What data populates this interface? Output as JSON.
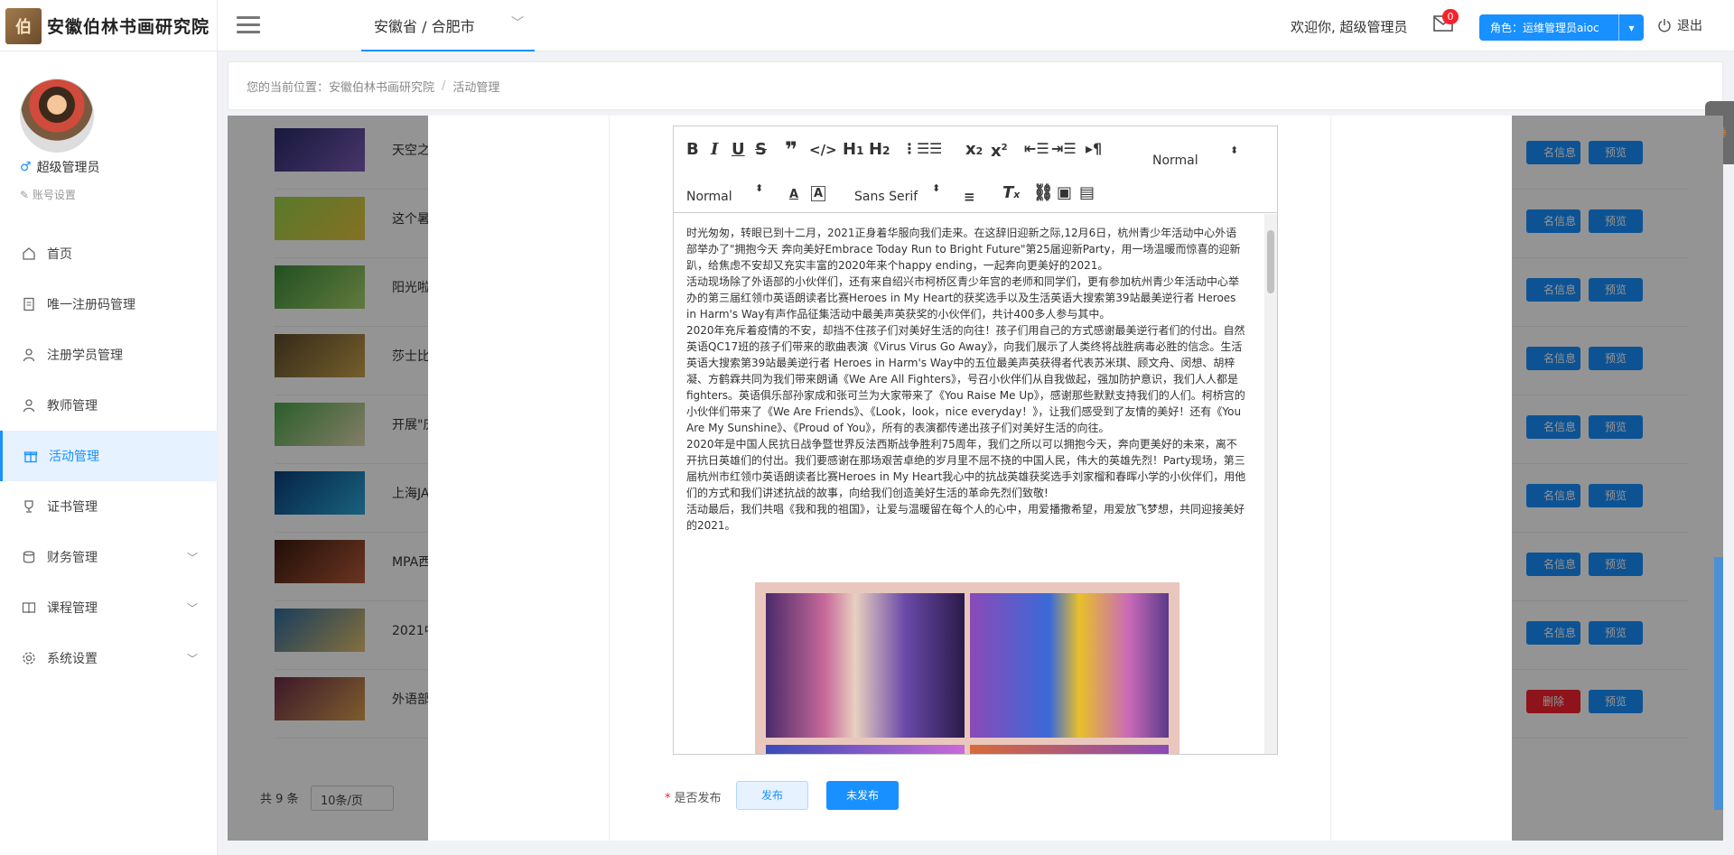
{
  "app": {
    "logo_mark": "伯",
    "logo_text": "安徽伯林书画研究院"
  },
  "header": {
    "region": "安徽省 / 合肥市",
    "welcome": "欢迎你, 超级管理员",
    "mail_count": "0",
    "role": "角色：运维管理员aioc",
    "logout": "退出"
  },
  "user": {
    "name": "超级管理员",
    "account_settings": "账号设置"
  },
  "sidebar": {
    "items": [
      {
        "label": "首页",
        "icon": "home-icon"
      },
      {
        "label": "唯一注册码管理",
        "icon": "document-icon"
      },
      {
        "label": "注册学员管理",
        "icon": "user-icon"
      },
      {
        "label": "教师管理",
        "icon": "user-icon"
      },
      {
        "label": "活动管理",
        "icon": "gift-icon",
        "active": true
      },
      {
        "label": "证书管理",
        "icon": "trophy-icon"
      },
      {
        "label": "财务管理",
        "icon": "database-icon",
        "expandable": true
      },
      {
        "label": "课程管理",
        "icon": "book-icon",
        "expandable": true
      },
      {
        "label": "系统设置",
        "icon": "gear-icon",
        "expandable": true
      }
    ]
  },
  "breadcrumb": {
    "prefix": "您的当前位置：",
    "root": "安徽伯林书画研究院",
    "current": "活动管理"
  },
  "table": {
    "rows": [
      {
        "title": "天空之",
        "btn1": "名信息",
        "btn2": "预览"
      },
      {
        "title": "这个暑",
        "btn1": "名信息",
        "btn2": "预览"
      },
      {
        "title": "阳光啦",
        "btn1": "名信息",
        "btn2": "预览"
      },
      {
        "title": "莎士比",
        "btn1": "名信息",
        "btn2": "预览"
      },
      {
        "title": "开展\"庆",
        "btn1": "名信息",
        "btn2": "预览"
      },
      {
        "title": "上海JA",
        "btn1": "名信息",
        "btn2": "预览"
      },
      {
        "title": "MPA西",
        "btn1": "名信息",
        "btn2": "预览"
      },
      {
        "title": "2021中",
        "btn1": "名信息",
        "btn2": "预览"
      },
      {
        "title": "外语部",
        "btn1": "删除",
        "btn2": "预览"
      }
    ],
    "total": "共 9 条",
    "page_size": "10条/页"
  },
  "editor": {
    "toolbar": {
      "header_select": "Normal",
      "size_select": "Normal",
      "font_select": "Sans Serif"
    },
    "paragraphs": [
      "时光匆匆，转眼已到十二月，2021正身着华服向我们走来。在这辞旧迎新之际,12月6日，杭州青少年活动中心外语部举办了\"拥抱今天 奔向美好Embrace Today Run to Bright Future\"第25届迎新Party，用一场温暖而惊喜的迎新趴，给焦虑不安却又充实丰富的2020年来个happy ending，一起奔向更美好的2021。",
      "活动现场除了外语部的小伙伴们，还有来自绍兴市柯桥区青少年宫的老师和同学们，更有参加杭州青少年活动中心举办的第三届红领巾英语朗读者比赛Heroes in My Heart的获奖选手以及生活英语大搜索第39站最美逆行者 Heroes in Harm's Way有声作品征集活动中最美声英获奖的小伙伴们，共计400多人参与其中。",
      "2020年充斥着疫情的不安，却挡不住孩子们对美好生活的向往！孩子们用自己的方式感谢最美逆行者们的付出。自然英语QC17班的孩子们带来的歌曲表演《Virus Virus Go Away》，向我们展示了人类终将战胜病毒必胜的信念。生活英语大搜索第39站最美逆行者 Heroes in Harm's Way中的五位最美声英获得者代表苏米琪、顾文舟、闵想、胡梓凝、方鹤霖共同为我们带来朗诵《We Are All Fighters》，号召小伙伴们从自我做起，强加防护意识，我们人人都是fighters。英语俱乐部孙家成和张可兰为大家带来了《You Raise Me Up》，感谢那些默默支持我们的人们。柯桥宫的小伙伴们带来了《We Are Friends》、《Look，look，nice everyday！》，让我们感受到了友情的美好！还有《You Are My Sunshine》、《Proud of You》，所有的表演都传递出孩子们对美好生活的向往。",
      "2020年是中国人民抗日战争暨世界反法西斯战争胜利75周年，我们之所以可以拥抱今天，奔向更美好的未来，离不开抗日英雄们的付出。我们要感谢在那场艰苦卓绝的岁月里不屈不挠的中国人民，伟大的英雄先烈！Party现场，第三届杭州市红领巾英语朗读者比赛Heroes in My Heart我心中的抗战英雄获奖选手刘家榴和春晖小学的小伙伴们，用他们的方式和我们讲述抗战的故事，向给我们创造美好生活的革命先烈们致敬!",
      "活动最后，我们共唱《我和我的祖国》，让爱与温暖留在每个人的心中，用爱播撒希望，用爱放飞梦想，共同迎接美好的2021。"
    ]
  },
  "form": {
    "publish_label": "是否发布",
    "publish": "发布",
    "unpublish": "未发布"
  },
  "colors": {
    "accent": "#1890ff",
    "danger": "#f5222d"
  }
}
